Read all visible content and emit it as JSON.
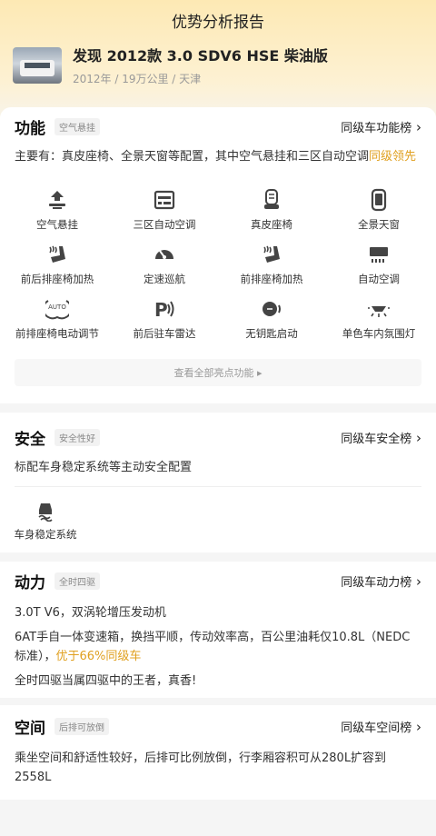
{
  "header": {
    "title": "优势分析报告"
  },
  "car": {
    "name": "发现 2012款 3.0 SDV6 HSE 柴油版",
    "meta": "2012年 / 19万公里 / 天津"
  },
  "function": {
    "title": "功能",
    "tag": "空气悬挂",
    "rank": "同级车功能榜",
    "desc_main": "主要有：真皮座椅、全景天窗等配置，其中空气悬挂和三区自动空调",
    "desc_hl": "同级领先",
    "features": [
      {
        "label": "空气悬挂",
        "icon": "air-suspension-icon"
      },
      {
        "label": "三区自动空调",
        "icon": "tri-zone-ac-icon"
      },
      {
        "label": "真皮座椅",
        "icon": "leather-seat-icon"
      },
      {
        "label": "全景天窗",
        "icon": "panoramic-sunroof-icon"
      },
      {
        "label": "前后排座椅加热",
        "icon": "seat-heating-icon"
      },
      {
        "label": "定速巡航",
        "icon": "cruise-control-icon"
      },
      {
        "label": "前排座椅加热",
        "icon": "front-seat-heating-icon"
      },
      {
        "label": "自动空调",
        "icon": "auto-ac-icon"
      },
      {
        "label": "前排座椅电动调节",
        "icon": "power-seat-icon"
      },
      {
        "label": "前后驻车雷达",
        "icon": "parking-radar-icon"
      },
      {
        "label": "无钥匙启动",
        "icon": "keyless-start-icon"
      },
      {
        "label": "单色车内氛围灯",
        "icon": "ambient-light-icon"
      }
    ],
    "more": "查看全部亮点功能 ▸"
  },
  "safety": {
    "title": "安全",
    "tag": "安全性好",
    "rank": "同级车安全榜",
    "desc": "标配车身稳定系统等主动安全配置",
    "feature": {
      "label": "车身稳定系统",
      "icon": "stability-control-icon"
    }
  },
  "power": {
    "title": "动力",
    "tag": "全时四驱",
    "rank": "同级车动力榜",
    "line1": "3.0T V6，双涡轮增压发动机",
    "line2_main": "6AT手自一体变速箱，换挡平顺，传动效率高，百公里油耗仅10.8L（NEDC标准），",
    "line2_hl": "优于66%同级车",
    "line3": "全时四驱当属四驱中的王者，真香!"
  },
  "space": {
    "title": "空间",
    "tag": "后排可放倒",
    "rank": "同级车空间榜",
    "desc": "乘坐空间和舒适性较好，后排可比例放倒，行李厢容积可从280L扩容到2558L"
  },
  "colors": {
    "accent": "#e0a020",
    "hero": "#fde9b4"
  }
}
